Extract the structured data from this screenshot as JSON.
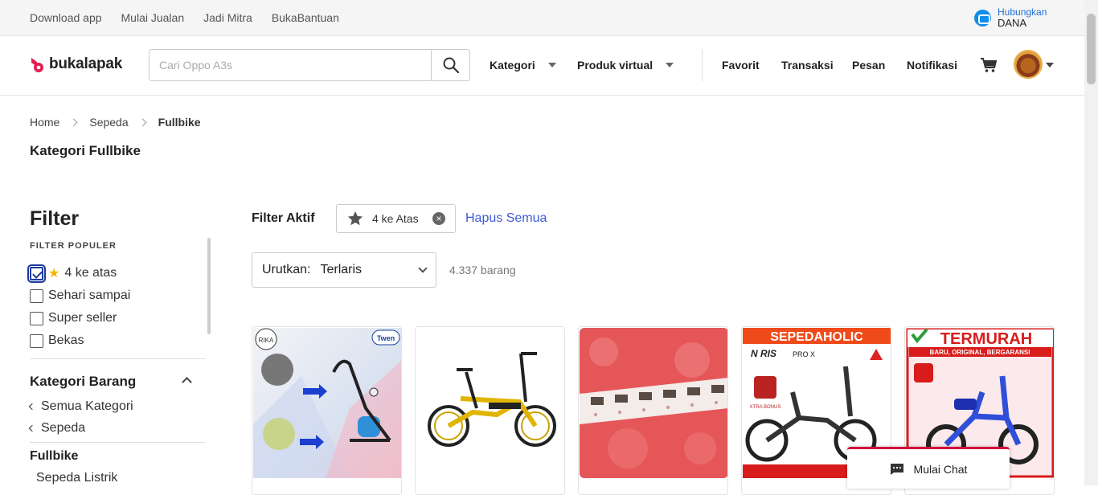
{
  "topbar": {
    "links": [
      "Download app",
      "Mulai Jualan",
      "Jadi Mitra",
      "BukaBantuan"
    ],
    "dana_line1": "Hubungkan",
    "dana_line2": "DANA"
  },
  "header": {
    "logo_text": "bukalapak",
    "search_placeholder": "Cari Oppo A3s",
    "nav_kategori": "Kategori",
    "nav_produk": "Produk virtual",
    "links": [
      "Favorit",
      "Transaksi",
      "Pesan",
      "Notifikasi"
    ],
    "brand_color": "#e31e52"
  },
  "breadcrumb": [
    "Home",
    "Sepeda",
    "Fullbike"
  ],
  "page_title": "Kategori Fullbike",
  "filter": {
    "title": "Filter",
    "popular_label": "FILTER POPULER",
    "items": [
      {
        "label": "4 ke atas",
        "checked": true,
        "icon": "star-icon"
      },
      {
        "label": "Sehari sampai",
        "checked": false
      },
      {
        "label": "Super seller",
        "checked": false
      },
      {
        "label": "Bekas",
        "checked": false
      }
    ],
    "kategori_title": "Kategori Barang",
    "kategori_links": [
      "Semua Kategori",
      "Sepeda"
    ],
    "current": "Fullbike",
    "sub": [
      "Sepeda Listrik"
    ]
  },
  "active_filter": {
    "label": "Filter Aktif",
    "chip": "4 ke Atas",
    "clear": "Hapus Semua"
  },
  "sort": {
    "label": "Urutkan:",
    "value": "Terlaris",
    "count": "4.337 barang"
  },
  "products": [
    {
      "image": "exercise-bike-ad"
    },
    {
      "image": "folding-bike-yellow"
    },
    {
      "image": "resistor-tape"
    },
    {
      "image": "sepedaholic-bike",
      "banner": "SEPEDAHOLIC"
    },
    {
      "image": "kids-bike-termurah",
      "banner": "TERMURAH"
    }
  ],
  "chat": {
    "label": "Mulai Chat"
  }
}
